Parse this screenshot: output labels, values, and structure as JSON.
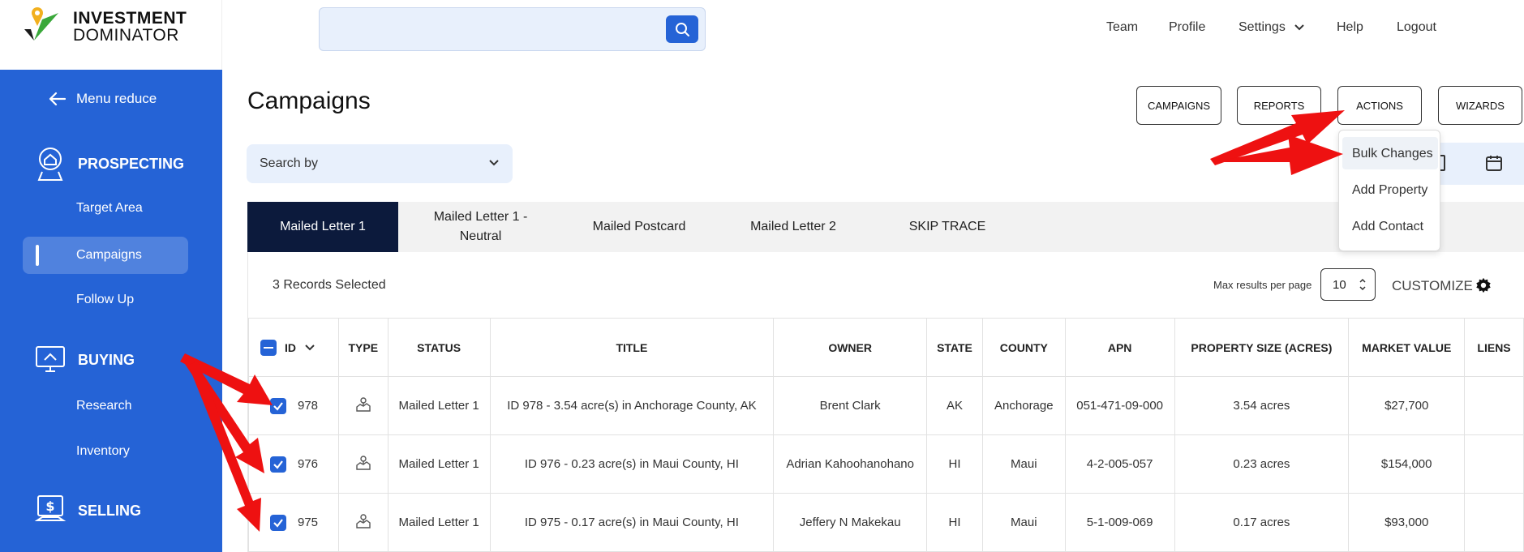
{
  "logo": {
    "line1": "INVESTMENT",
    "line2": "DOMINATOR"
  },
  "search": {
    "placeholder": ""
  },
  "topnav": {
    "team": "Team",
    "profile": "Profile",
    "settings": "Settings",
    "help": "Help",
    "logout": "Logout"
  },
  "sidebar": {
    "menu_reduce": "Menu reduce",
    "prospecting": "PROSPECTING",
    "target_area": "Target Area",
    "campaigns": "Campaigns",
    "follow_up": "Follow Up",
    "buying": "BUYING",
    "research": "Research",
    "inventory": "Inventory",
    "selling": "SELLING"
  },
  "header": {
    "title": "Campaigns",
    "btn_campaigns": "CAMPAIGNS",
    "btn_reports": "REPORTS",
    "btn_actions": "ACTIONS",
    "btn_wizards": "WIZARDS"
  },
  "actions_menu": {
    "bulk_changes": "Bulk Changes",
    "add_property": "Add Property",
    "add_contact": "Add Contact"
  },
  "filter": {
    "search_by": "Search by"
  },
  "tabs": [
    {
      "label": "Mailed Letter 1"
    },
    {
      "label": "Mailed Letter 1 - Neutral"
    },
    {
      "label": "Mailed Postcard"
    },
    {
      "label": "Mailed Letter 2"
    },
    {
      "label": "SKIP TRACE"
    }
  ],
  "toolbar": {
    "records_selected": "3 Records Selected",
    "max_results_label": "Max results per page",
    "max_results_value": "10",
    "customize": "CUSTOMIZE"
  },
  "table": {
    "headers": [
      "ID",
      "TYPE",
      "STATUS",
      "TITLE",
      "OWNER",
      "STATE",
      "COUNTY",
      "APN",
      "PROPERTY SIZE (ACRES)",
      "MARKET VALUE",
      "LIENS"
    ],
    "rows": [
      {
        "id": "978",
        "status": "Mailed Letter 1",
        "title": "ID 978 - 3.54 acre(s) in Anchorage County, AK",
        "owner": "Brent Clark",
        "state": "AK",
        "county": "Anchorage",
        "apn": "051-471-09-000",
        "size": "3.54 acres",
        "value": "$27,700",
        "liens": ""
      },
      {
        "id": "976",
        "status": "Mailed Letter 1",
        "title": "ID 976 - 0.23 acre(s) in Maui County, HI",
        "owner": "Adrian Kahoohanohano",
        "state": "HI",
        "county": "Maui",
        "apn": "4-2-005-057",
        "size": "0.23 acres",
        "value": "$154,000",
        "liens": ""
      },
      {
        "id": "975",
        "status": "Mailed Letter 1",
        "title": "ID 975 - 0.17 acre(s) in Maui County, HI",
        "owner": "Jeffery N Makekau",
        "state": "HI",
        "county": "Maui",
        "apn": "5-1-009-069",
        "size": "0.17 acres",
        "value": "$93,000",
        "liens": ""
      }
    ]
  },
  "colors": {
    "brand_blue": "#2563d6",
    "active_tab": "#0c1a3c",
    "annotation_red": "#ee1111"
  }
}
